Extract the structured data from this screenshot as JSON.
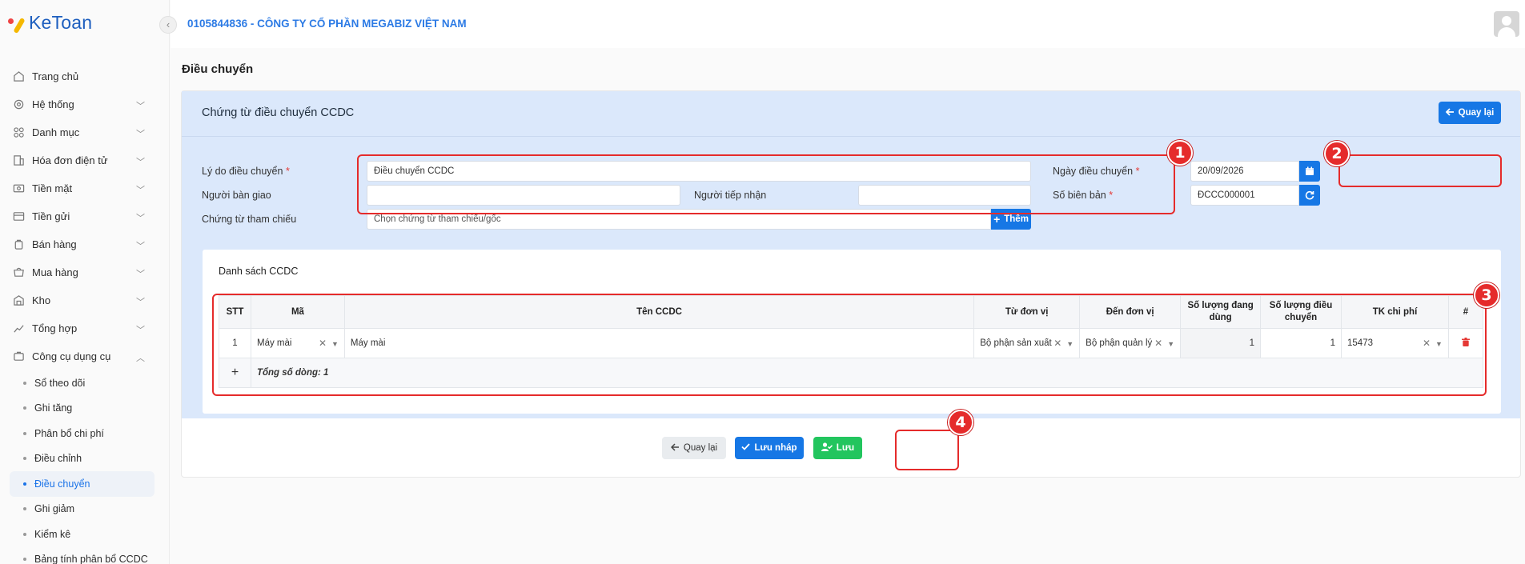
{
  "app": {
    "logo_text": "KeToan",
    "company": "0105844836 - CÔNG TY CỔ PHẦN MEGABIZ VIỆT NAM"
  },
  "sidebar": {
    "items": [
      {
        "label": "Trang chủ",
        "icon": "home-icon",
        "has_chevron": false
      },
      {
        "label": "Hệ thống",
        "icon": "gear-icon",
        "has_chevron": true
      },
      {
        "label": "Danh mục",
        "icon": "grid-icon",
        "has_chevron": true
      },
      {
        "label": "Hóa đơn điện tử",
        "icon": "invoice-icon",
        "has_chevron": true
      },
      {
        "label": "Tiền mặt",
        "icon": "cash-icon",
        "has_chevron": true
      },
      {
        "label": "Tiền gửi",
        "icon": "bank-icon",
        "has_chevron": true
      },
      {
        "label": "Bán hàng",
        "icon": "sales-icon",
        "has_chevron": true
      },
      {
        "label": "Mua hàng",
        "icon": "cart-icon",
        "has_chevron": true
      },
      {
        "label": "Kho",
        "icon": "warehouse-icon",
        "has_chevron": true
      },
      {
        "label": "Tổng hợp",
        "icon": "chart-icon",
        "has_chevron": true
      },
      {
        "label": "Công cụ dụng cụ",
        "icon": "tools-icon",
        "has_chevron": true,
        "expanded": true
      }
    ],
    "sub_items": [
      {
        "label": "Sổ theo dõi"
      },
      {
        "label": "Ghi tăng"
      },
      {
        "label": "Phân bổ chi phí"
      },
      {
        "label": "Điều chỉnh"
      },
      {
        "label": "Điều chuyển",
        "active": true
      },
      {
        "label": "Ghi giảm"
      },
      {
        "label": "Kiểm kê"
      },
      {
        "label": "Bảng tính phân bổ CCDC"
      }
    ]
  },
  "page": {
    "title": "Điều chuyển"
  },
  "form": {
    "card_title": "Chứng từ điều chuyển CCDC",
    "back_top_label": "Quay lại",
    "reason_label": "Lý do điều chuyển",
    "reason_value": "Điều chuyển CCDC",
    "sender_label": "Người bàn giao",
    "sender_value": "",
    "receiver_label": "Người tiếp nhận",
    "receiver_value": "",
    "ref_label": "Chứng từ tham chiếu",
    "ref_placeholder": "Chọn chứng từ tham chiếu/gốc",
    "add_label": "Thêm",
    "date_label": "Ngày điều chuyển",
    "date_value": "20/09/2026",
    "record_no_label": "Số biên bản",
    "record_no_value": "ĐCCC000001",
    "required_mark": "*"
  },
  "list": {
    "title": "Danh sách CCDC",
    "columns": [
      "STT",
      "Mã",
      "Tên CCDC",
      "Từ đơn vị",
      "Đến đơn vị",
      "Số lượng đang dùng",
      "Số lượng điều chuyển",
      "TK chi phí",
      "#"
    ],
    "rows": [
      {
        "stt": "1",
        "code": "Máy mài",
        "name": "Máy mài",
        "from_unit": "Bộ phận sản xuất",
        "to_unit": "Bộ phận quản lý",
        "qty_in_use": "1",
        "qty_transfer": "1",
        "account": "15473"
      }
    ],
    "total_label": "Tổng số dòng: 1"
  },
  "footer": {
    "back_label": "Quay lại",
    "draft_label": "Lưu nháp",
    "save_label": "Lưu"
  },
  "annotations": [
    "1",
    "2",
    "3",
    "4"
  ],
  "colors": {
    "primary": "#1677e5",
    "success": "#22c55e",
    "annotation": "#e52b2b",
    "brand": "#1e5fbf"
  }
}
